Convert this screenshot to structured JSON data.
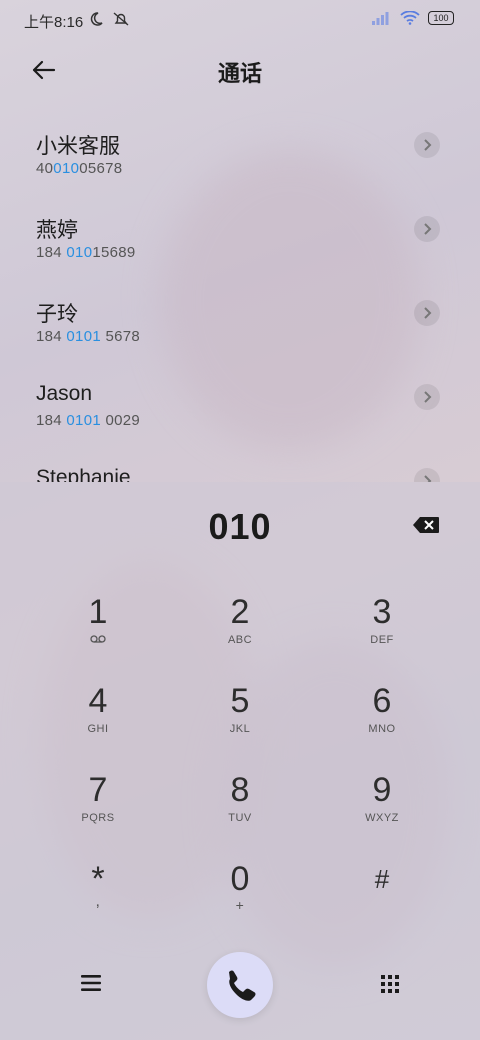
{
  "status_bar": {
    "time": "上午8:16",
    "battery": "100"
  },
  "header": {
    "title": "通话"
  },
  "contacts": [
    {
      "name": "小米客服",
      "num_pre": "40",
      "num_hl": "010",
      "num_post": "05678"
    },
    {
      "name": "燕婷",
      "num_pre": "184 ",
      "num_hl": "010",
      "num_post": "15689"
    },
    {
      "name": "子玲",
      "num_pre": "184 ",
      "num_hl": "0101",
      "num_post": " 5678"
    },
    {
      "name": "Jason",
      "num_pre": "184 ",
      "num_hl": "0101",
      "num_post": " 0029"
    },
    {
      "name": "Stephanie",
      "num_pre": "",
      "num_hl": "",
      "num_post": ""
    }
  ],
  "dialer": {
    "typed": "010"
  },
  "keys": [
    {
      "digit": "1",
      "sub": "voicemail-icon"
    },
    {
      "digit": "2",
      "sub": "ABC"
    },
    {
      "digit": "3",
      "sub": "DEF"
    },
    {
      "digit": "4",
      "sub": "GHI"
    },
    {
      "digit": "5",
      "sub": "JKL"
    },
    {
      "digit": "6",
      "sub": "MNO"
    },
    {
      "digit": "7",
      "sub": "PQRS"
    },
    {
      "digit": "8",
      "sub": "TUV"
    },
    {
      "digit": "9",
      "sub": "WXYZ"
    },
    {
      "digit": "*",
      "sub": ","
    },
    {
      "digit": "0",
      "sub": "+"
    },
    {
      "digit": "#",
      "sub": ""
    }
  ],
  "icons": {
    "back": "back-arrow-icon",
    "delete": "backspace-icon",
    "menu": "hamburger-menu-icon",
    "call": "phone-icon",
    "keypad": "dialpad-icon"
  }
}
